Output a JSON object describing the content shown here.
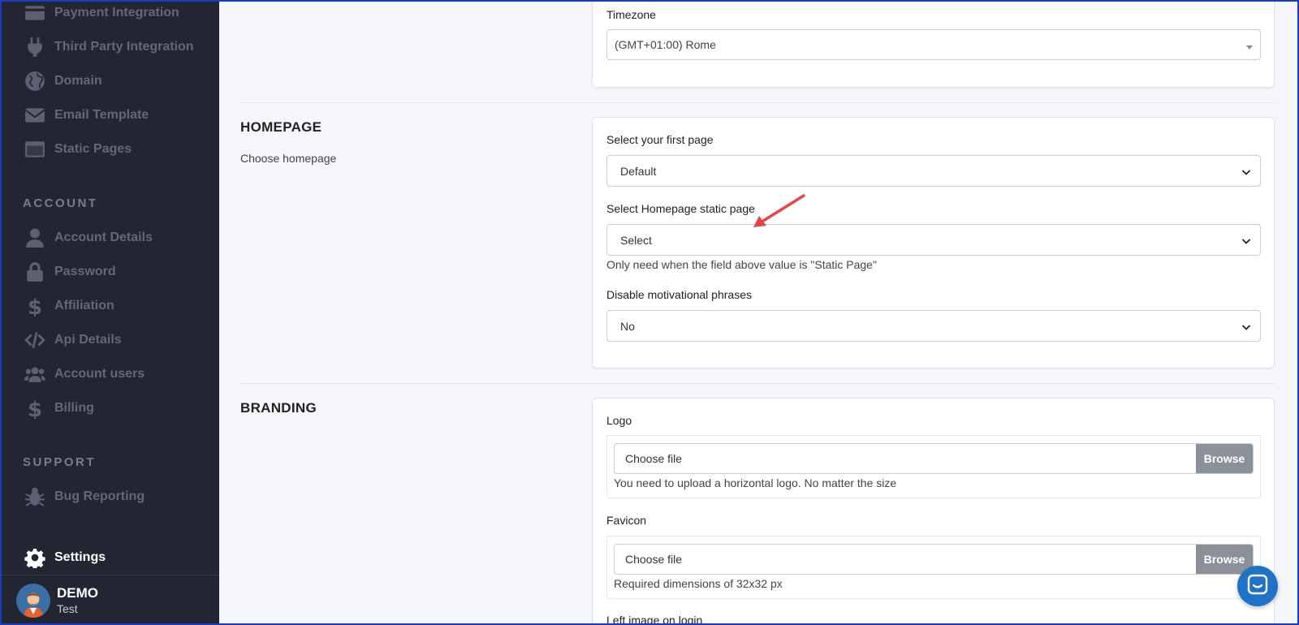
{
  "sidebar": {
    "items_top": [
      {
        "label": "Payment Integration",
        "icon": "credit-card-icon"
      },
      {
        "label": "Third Party Integration",
        "icon": "plug-icon"
      },
      {
        "label": "Domain",
        "icon": "globe-icon"
      },
      {
        "label": "Email Template",
        "icon": "envelope-icon"
      },
      {
        "label": "Static Pages",
        "icon": "browser-window-icon"
      }
    ],
    "account_title": "ACCOUNT",
    "account_items": [
      {
        "label": "Account Details",
        "icon": "user-icon"
      },
      {
        "label": "Password",
        "icon": "lock-icon"
      },
      {
        "label": "Affiliation",
        "icon": "dollar-icon"
      },
      {
        "label": "Api Details",
        "icon": "code-icon"
      },
      {
        "label": "Account users",
        "icon": "users-icon"
      },
      {
        "label": "Billing",
        "icon": "dollar-icon"
      }
    ],
    "support_title": "SUPPORT",
    "support_items": [
      {
        "label": "Bug Reporting",
        "icon": "bug-icon"
      }
    ],
    "settings_label": "Settings",
    "user": {
      "name": "DEMO",
      "role": "Test"
    }
  },
  "timezone": {
    "label": "Timezone",
    "value": "(GMT+01:00) Rome"
  },
  "homepage": {
    "title": "HOMEPAGE",
    "description": "Choose homepage",
    "first_page_label": "Select your first page",
    "first_page_value": "Default",
    "static_page_label": "Select Homepage static page",
    "static_page_value": "Select",
    "static_page_help": "Only need when the field above value is \"Static Page\"",
    "motivational_label": "Disable motivational phrases",
    "motivational_value": "No"
  },
  "branding": {
    "title": "BRANDING",
    "logo_label": "Logo",
    "logo_placeholder": "Choose file",
    "logo_browse": "Browse",
    "logo_help": "You need to upload a horizontal logo. No matter the size",
    "favicon_label": "Favicon",
    "favicon_placeholder": "Choose file",
    "favicon_browse": "Browse",
    "favicon_help": "Required dimensions of 32x32 px",
    "left_image_label": "Left image on login"
  },
  "colors": {
    "sidebar_bg": "#222632",
    "accent_arrow": "#e84545",
    "chat_button": "#1e73c8"
  }
}
